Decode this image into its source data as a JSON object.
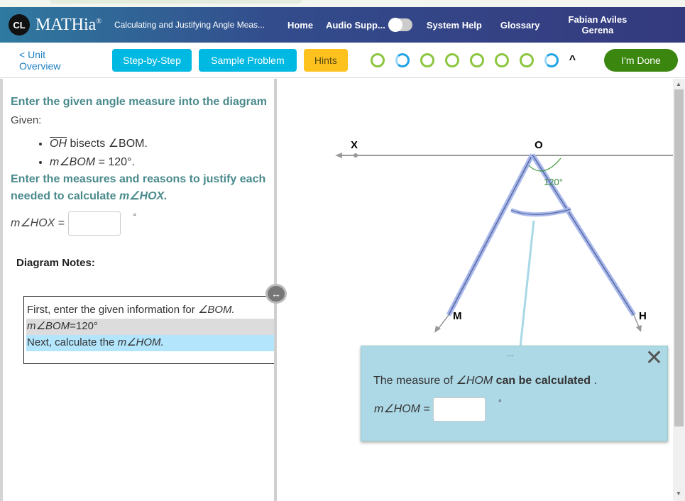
{
  "header": {
    "logo": "CL",
    "brand": "MATHia",
    "course": "Calculating and Justifying Angle Meas...",
    "nav": [
      "Home",
      "Audio Supp...",
      "System Help",
      "Glossary"
    ],
    "user": [
      "Fabian Aviles",
      "Gerena"
    ],
    "audio_toggle": "off"
  },
  "toolbar": {
    "back": "< Unit Overview",
    "step": "Step-by-Step",
    "sample": "Sample Problem",
    "hints": "Hints",
    "progress": [
      "complete",
      "in-progress",
      "complete",
      "complete",
      "complete",
      "complete",
      "complete",
      "in-progress"
    ],
    "collapse": "^",
    "done": "I'm Done"
  },
  "colors": {
    "accent": "#00b9e2",
    "hints": "#fdc21e",
    "done": "#3a860f",
    "teal": "#4a8a8c"
  },
  "left": {
    "instruction1": "Enter the given angle measure into the diagram",
    "given": "Given:",
    "bullets": [
      {
        "seg": "OH",
        "rest": " bisects ∠BOM."
      },
      {
        "math": "m∠BOM",
        "rest": " = 120°."
      }
    ],
    "instruction2a": "Enter the measures and reasons to justify each",
    "instruction2b": "needed to calculate ",
    "instruction2m": "m∠HOX.",
    "eq_label": "m∠HOX",
    "eq_sign": " = ",
    "eq_value": "",
    "degree": "°",
    "notes_title": "Diagram Notes:",
    "notes": [
      "First, enter the given information for ",
      "∠BOM.",
      "m∠BOM",
      "=120°",
      "Next, calculate the ",
      "m∠HOM."
    ]
  },
  "diagram": {
    "labels": {
      "X": "X",
      "O": "O",
      "M": "M",
      "H": "H"
    },
    "angle": "120°"
  },
  "popup": {
    "dots": "...",
    "msg1": "The measure of ",
    "msg_math": "∠HOM",
    "msg_bold": " can be calculated",
    "msg_end": " .",
    "eq_label": "m∠HOM",
    "eq_sign": " = ",
    "value": "",
    "degree": "°"
  }
}
